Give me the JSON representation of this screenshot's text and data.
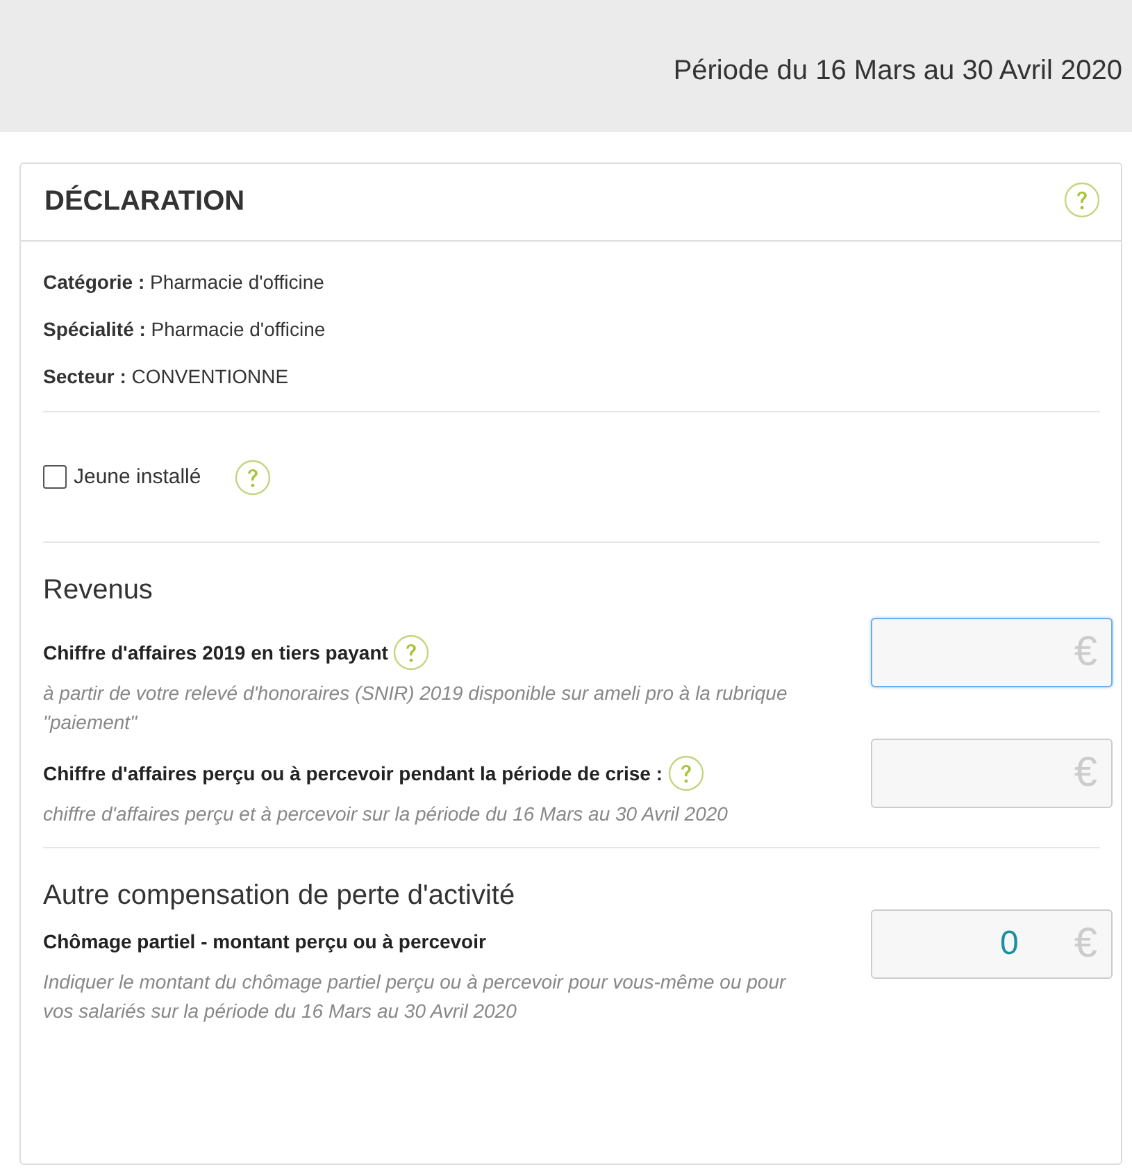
{
  "header": {
    "period": "Période du 16 Mars au 30 Avril 2020"
  },
  "card": {
    "title": "DÉCLARATION",
    "help": true
  },
  "info": [
    {
      "label": "Catégorie :",
      "value": "Pharmacie d'officine"
    },
    {
      "label": "Spécialité :",
      "value": "Pharmacie d'officine"
    },
    {
      "label": "Secteur :",
      "value": "CONVENTIONNE"
    }
  ],
  "checkbox": {
    "label": "Jeune installé",
    "checked": false,
    "help": true
  },
  "sections": [
    {
      "title": "Revenus",
      "fields": [
        {
          "label": "Chiffre d'affaires 2019 en tiers payant",
          "help": true,
          "hint": "à partir de votre relevé d'honoraires (SNIR) 2019 disponible sur ameli pro à la rubrique \"paiement\"",
          "unit": "€",
          "focused": true
        },
        {
          "label": "Chiffre d'affaires perçu ou à percevoir pendant la période de crise :",
          "help": true,
          "hint": "chiffre d'affaires perçu et à percevoir sur la période du 16 Mars au 30 Avril 2020",
          "unit": "€",
          "focused": false
        }
      ]
    },
    {
      "title": "Autre compensation de perte d'activité",
      "fields": [
        {
          "label": "Chômage partiel - montant perçu ou à percevoir",
          "help": false,
          "hint": "Indiquer le montant du chômage partiel perçu ou à percevoir pour vous-même ou pour vos salariés sur la période du 16 Mars au 30 Avril 2020",
          "value": "0",
          "unit": "€",
          "focused": false
        }
      ]
    }
  ]
}
